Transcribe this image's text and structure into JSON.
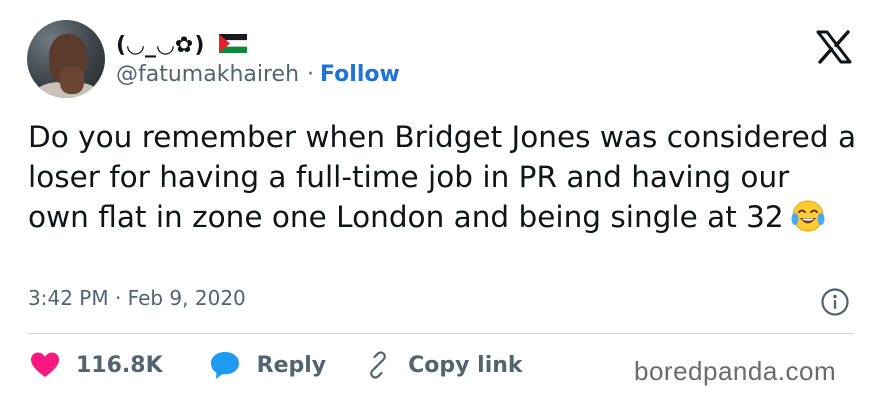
{
  "tweet": {
    "display_name": "(◡_◡✿)",
    "handle": "@fatumakhaireh",
    "separator": "·",
    "follow_label": "Follow",
    "text": "Do you remember when Bridget Jones was considered a loser for having a full-time job in PR and having our own flat in zone one London and being single at 32",
    "timestamp": "3:42 PM · Feb 9, 2020"
  },
  "actions": {
    "like_count": "116.8K",
    "reply_label": "Reply",
    "copy_link_label": "Copy link"
  },
  "watermark": "boredpanda.com",
  "colors": {
    "like": "#f91880",
    "reply": "#1d9bf0",
    "follow": "#1d73d6",
    "muted": "#536471"
  },
  "icons": [
    "palestine-flag-icon",
    "x-logo-icon",
    "laughing-emoji-icon",
    "info-icon",
    "heart-icon",
    "reply-bubble-icon",
    "link-icon"
  ]
}
